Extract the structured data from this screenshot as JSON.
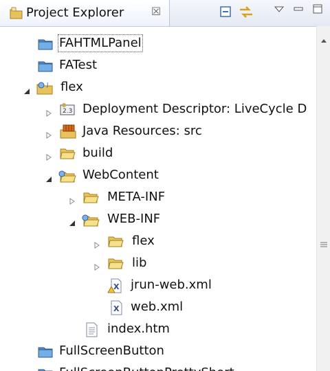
{
  "view": {
    "title": "Project Explorer",
    "close_glyph": "☒"
  },
  "toolbar": {
    "buttons": [
      "collapse-all-icon",
      "link-with-editor-icon",
      "view-menu-icon",
      "minimize-icon",
      "maximize-icon"
    ]
  },
  "tree": {
    "fahtml": "FAHTMLPanel",
    "fatest": "FATest",
    "flex": "flex",
    "deploy": "Deployment Descriptor: LiveCycle D",
    "javares": "Java Resources: src",
    "build": "build",
    "webcontent": "WebContent",
    "metainf": "META-INF",
    "webinf": "WEB-INF",
    "flex_sub": "flex",
    "lib": "lib",
    "jrun": "jrun-web.xml",
    "webxml": "web.xml",
    "index": "index.htm",
    "fullscreen": "FullScreenButton",
    "fullscreen2": "FullScreenButtonPrettyShort"
  },
  "colors": {
    "folder": "#e8c25c",
    "project": "#4f8fd0",
    "selection_outline": "#555555"
  }
}
